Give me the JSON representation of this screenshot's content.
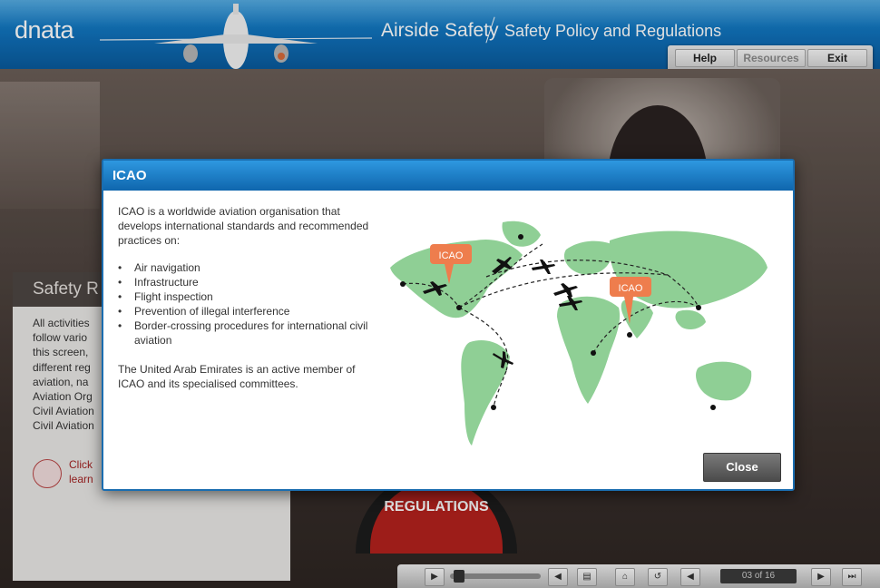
{
  "header": {
    "logo": "dnata",
    "course_title": "Airside Safety",
    "course_subtitle": "Safety Policy and Regulations",
    "nav": {
      "help": "Help",
      "resources": "Resources",
      "exit": "Exit"
    }
  },
  "background": {
    "panel_title": "Safety R",
    "panel_text": "All activities\nfollow vario\nthis screen,\ndifferent reg\naviation, na\nAviation Org\nCivil Aviation\nCivil Aviation",
    "click_text": "Click\nlearn",
    "badge_label": "REGULATIONS"
  },
  "modal": {
    "title": "ICAO",
    "intro": "ICAO is a worldwide aviation organisation that develops international standards and recommended practices on:",
    "bullets": [
      "Air navigation",
      "Infrastructure",
      "Flight inspection",
      "Prevention of illegal interference",
      "Border-crossing procedures for international civil aviation"
    ],
    "closing": "The United Arab Emirates is an active member of ICAO and its specialised committees.",
    "map_pins": [
      "ICAO",
      "ICAO"
    ],
    "close_label": "Close",
    "colors": {
      "header": "#1a7cc8",
      "land": "#8fcf95",
      "pin": "#ee7d4d"
    }
  },
  "player": {
    "counter": "03 of 16",
    "icons": [
      "play-icon",
      "volume-icon",
      "transcript-icon",
      "home-icon",
      "replay-icon",
      "back-icon",
      "next-icon",
      "skip-icon"
    ]
  }
}
